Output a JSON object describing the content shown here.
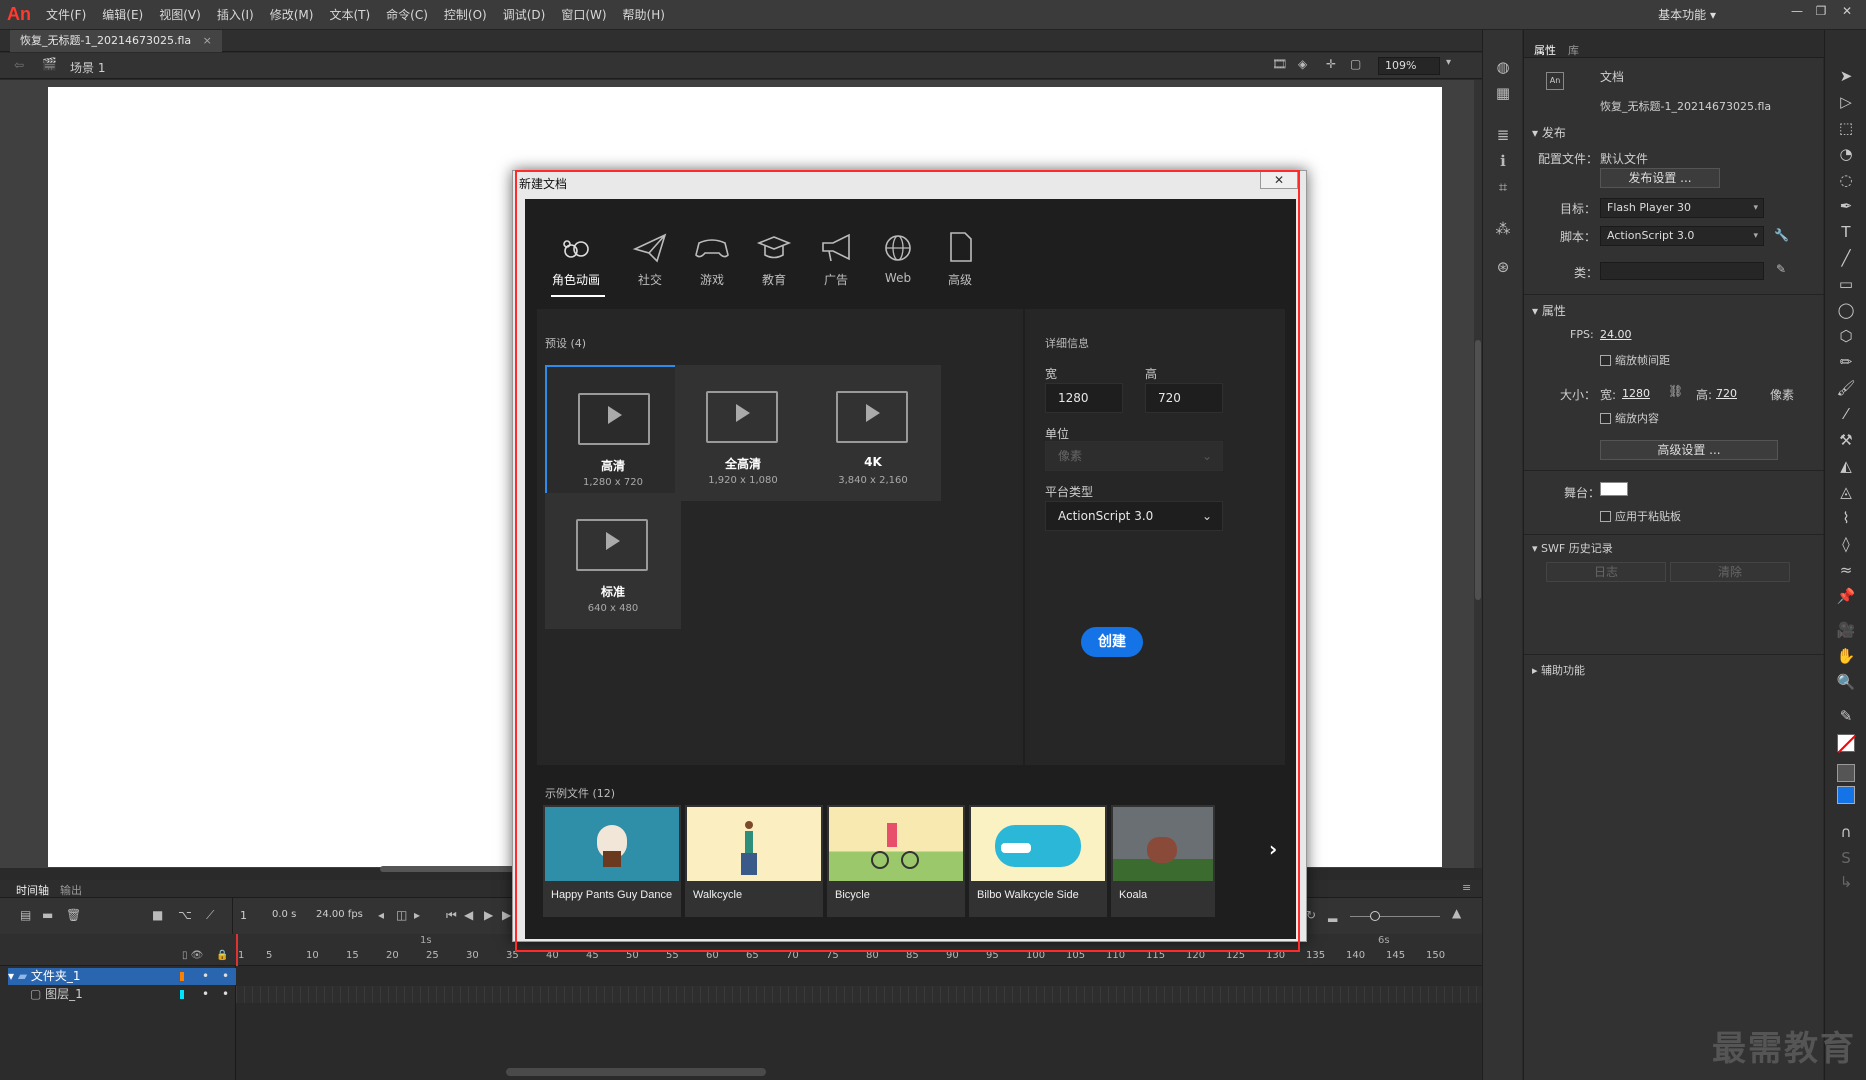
{
  "app": {
    "logo": "An",
    "menu": [
      "文件(F)",
      "编辑(E)",
      "视图(V)",
      "插入(I)",
      "修改(M)",
      "文本(T)",
      "命令(C)",
      "控制(O)",
      "调试(D)",
      "窗口(W)",
      "帮助(H)"
    ],
    "workspace": "基本功能",
    "min": "—",
    "restore": "❐",
    "close": "✕"
  },
  "doc_tab": {
    "name": "恢复_无标题-1_20214673025.fla",
    "close": "×"
  },
  "scene": {
    "name": "场景 1",
    "zoom": "109%"
  },
  "properties": {
    "tab_props": "属性",
    "tab_lib": "库",
    "doc_label": "文档",
    "doc_name": "恢复_无标题-1_20214673025.fla",
    "publish_section": "发布",
    "profile_label": "配置文件：",
    "profile_value": "默认文件",
    "publish_settings_btn": "发布设置 ...",
    "target_label": "目标：",
    "target_value": "Flash Player 30",
    "script_label": "脚本：",
    "script_value": "ActionScript 3.0",
    "class_label": "类：",
    "attr_section": "属性",
    "fps_label": "FPS:",
    "fps_value": "24.00",
    "scale_interval": "缩放帧间距",
    "size_label": "大小：",
    "width_label": "宽:",
    "width_value": "1280",
    "height_label": "高:",
    "height_value": "720",
    "unit": "像素",
    "scale_content": "缩放内容",
    "advanced_btn": "高级设置 ...",
    "stage_label": "舞台：",
    "apply_pasteboard": "应用于粘贴板",
    "swf_section": "SWF 历史记录",
    "log_btn": "日志",
    "clear_btn": "清除",
    "access_section": "辅助功能"
  },
  "timeline": {
    "tab_timeline": "时间轴",
    "tab_output": "输出",
    "frame": "1",
    "time": "0.0 s",
    "fps": "24.00 fps",
    "ruler_1s": "1s",
    "ruler_6s": "6s",
    "ticks": [
      "1",
      "5",
      "10",
      "15",
      "20",
      "25",
      "30",
      "35",
      "40",
      "45",
      "50",
      "55",
      "60",
      "65",
      "70",
      "75",
      "80",
      "85",
      "90",
      "95",
      "100",
      "105",
      "110",
      "115",
      "120",
      "125",
      "130",
      "135",
      "140",
      "145",
      "150"
    ],
    "layers": [
      {
        "name": "文件夹_1",
        "color": "#ff7f00"
      },
      {
        "name": "图层_1",
        "color": "#00e5ff"
      }
    ]
  },
  "dialog": {
    "title": "新建文档",
    "close": "✕",
    "categories": [
      "角色动画",
      "社交",
      "游戏",
      "教育",
      "广告",
      "Web",
      "高级"
    ],
    "presets_title": "预设 (4)",
    "presets": [
      {
        "name": "高清",
        "dims": "1,280 x 720"
      },
      {
        "name": "全高清",
        "dims": "1,920 x 1,080"
      },
      {
        "name": "4K",
        "dims": "3,840 x 2,160"
      },
      {
        "name": "标准",
        "dims": "640 x 480"
      }
    ],
    "details_title": "详细信息",
    "width_label": "宽",
    "height_label": "高",
    "width_value": "1280",
    "height_value": "720",
    "unit_label": "单位",
    "unit_value": "像素",
    "platform_label": "平台类型",
    "platform_value": "ActionScript 3.0",
    "create_btn": "创建",
    "samples_title": "示例文件 (12)",
    "samples": [
      "Happy Pants Guy Dance",
      "Walkcycle",
      "Bicycle",
      "Bilbo Walkcycle Side",
      "Koala"
    ],
    "next": "›"
  },
  "accent_color": "#1473e6",
  "highlight_color": "#ff2b2b",
  "watermark": "最需教育"
}
